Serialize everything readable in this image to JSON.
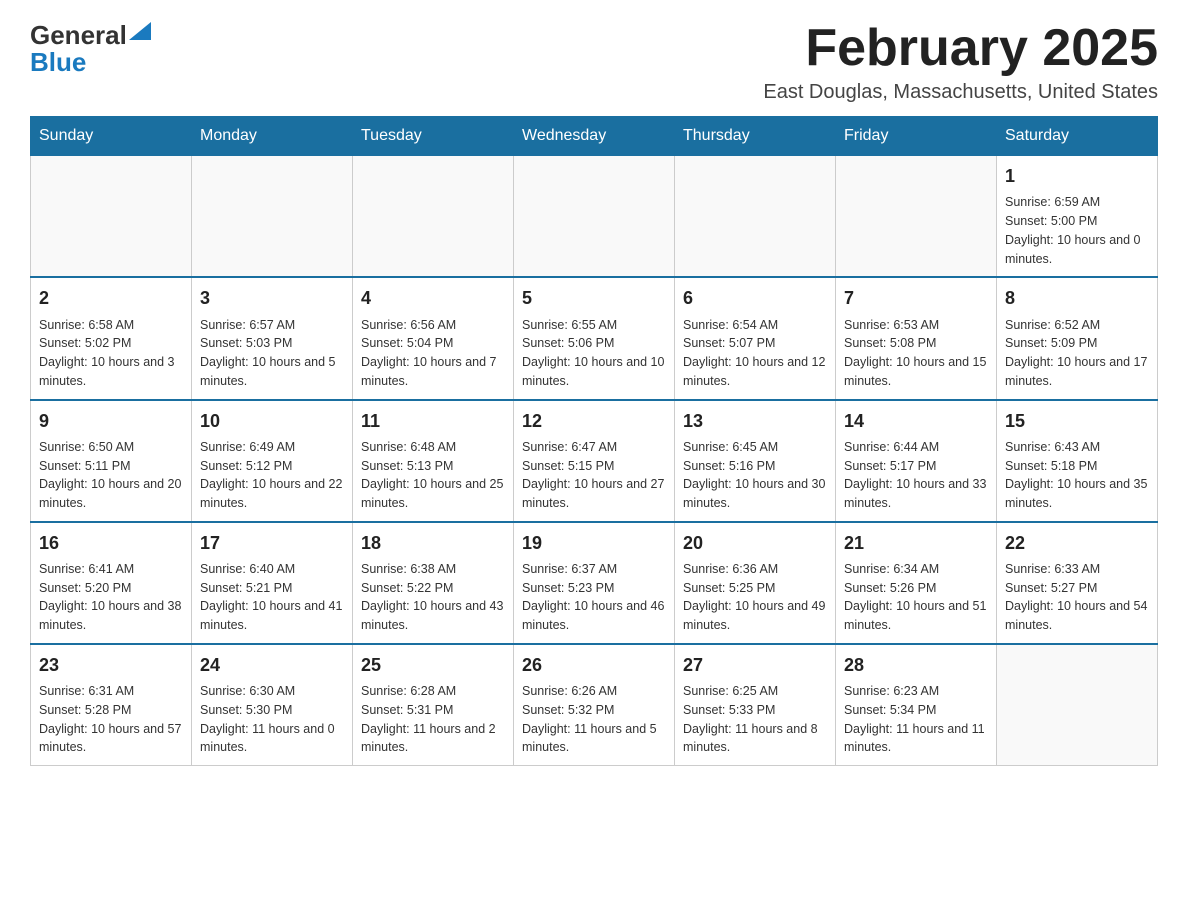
{
  "logo": {
    "general": "General",
    "blue": "Blue"
  },
  "title": "February 2025",
  "location": "East Douglas, Massachusetts, United States",
  "days_of_week": [
    "Sunday",
    "Monday",
    "Tuesday",
    "Wednesday",
    "Thursday",
    "Friday",
    "Saturday"
  ],
  "weeks": [
    [
      {
        "day": "",
        "info": ""
      },
      {
        "day": "",
        "info": ""
      },
      {
        "day": "",
        "info": ""
      },
      {
        "day": "",
        "info": ""
      },
      {
        "day": "",
        "info": ""
      },
      {
        "day": "",
        "info": ""
      },
      {
        "day": "1",
        "info": "Sunrise: 6:59 AM\nSunset: 5:00 PM\nDaylight: 10 hours and 0 minutes."
      }
    ],
    [
      {
        "day": "2",
        "info": "Sunrise: 6:58 AM\nSunset: 5:02 PM\nDaylight: 10 hours and 3 minutes."
      },
      {
        "day": "3",
        "info": "Sunrise: 6:57 AM\nSunset: 5:03 PM\nDaylight: 10 hours and 5 minutes."
      },
      {
        "day": "4",
        "info": "Sunrise: 6:56 AM\nSunset: 5:04 PM\nDaylight: 10 hours and 7 minutes."
      },
      {
        "day": "5",
        "info": "Sunrise: 6:55 AM\nSunset: 5:06 PM\nDaylight: 10 hours and 10 minutes."
      },
      {
        "day": "6",
        "info": "Sunrise: 6:54 AM\nSunset: 5:07 PM\nDaylight: 10 hours and 12 minutes."
      },
      {
        "day": "7",
        "info": "Sunrise: 6:53 AM\nSunset: 5:08 PM\nDaylight: 10 hours and 15 minutes."
      },
      {
        "day": "8",
        "info": "Sunrise: 6:52 AM\nSunset: 5:09 PM\nDaylight: 10 hours and 17 minutes."
      }
    ],
    [
      {
        "day": "9",
        "info": "Sunrise: 6:50 AM\nSunset: 5:11 PM\nDaylight: 10 hours and 20 minutes."
      },
      {
        "day": "10",
        "info": "Sunrise: 6:49 AM\nSunset: 5:12 PM\nDaylight: 10 hours and 22 minutes."
      },
      {
        "day": "11",
        "info": "Sunrise: 6:48 AM\nSunset: 5:13 PM\nDaylight: 10 hours and 25 minutes."
      },
      {
        "day": "12",
        "info": "Sunrise: 6:47 AM\nSunset: 5:15 PM\nDaylight: 10 hours and 27 minutes."
      },
      {
        "day": "13",
        "info": "Sunrise: 6:45 AM\nSunset: 5:16 PM\nDaylight: 10 hours and 30 minutes."
      },
      {
        "day": "14",
        "info": "Sunrise: 6:44 AM\nSunset: 5:17 PM\nDaylight: 10 hours and 33 minutes."
      },
      {
        "day": "15",
        "info": "Sunrise: 6:43 AM\nSunset: 5:18 PM\nDaylight: 10 hours and 35 minutes."
      }
    ],
    [
      {
        "day": "16",
        "info": "Sunrise: 6:41 AM\nSunset: 5:20 PM\nDaylight: 10 hours and 38 minutes."
      },
      {
        "day": "17",
        "info": "Sunrise: 6:40 AM\nSunset: 5:21 PM\nDaylight: 10 hours and 41 minutes."
      },
      {
        "day": "18",
        "info": "Sunrise: 6:38 AM\nSunset: 5:22 PM\nDaylight: 10 hours and 43 minutes."
      },
      {
        "day": "19",
        "info": "Sunrise: 6:37 AM\nSunset: 5:23 PM\nDaylight: 10 hours and 46 minutes."
      },
      {
        "day": "20",
        "info": "Sunrise: 6:36 AM\nSunset: 5:25 PM\nDaylight: 10 hours and 49 minutes."
      },
      {
        "day": "21",
        "info": "Sunrise: 6:34 AM\nSunset: 5:26 PM\nDaylight: 10 hours and 51 minutes."
      },
      {
        "day": "22",
        "info": "Sunrise: 6:33 AM\nSunset: 5:27 PM\nDaylight: 10 hours and 54 minutes."
      }
    ],
    [
      {
        "day": "23",
        "info": "Sunrise: 6:31 AM\nSunset: 5:28 PM\nDaylight: 10 hours and 57 minutes."
      },
      {
        "day": "24",
        "info": "Sunrise: 6:30 AM\nSunset: 5:30 PM\nDaylight: 11 hours and 0 minutes."
      },
      {
        "day": "25",
        "info": "Sunrise: 6:28 AM\nSunset: 5:31 PM\nDaylight: 11 hours and 2 minutes."
      },
      {
        "day": "26",
        "info": "Sunrise: 6:26 AM\nSunset: 5:32 PM\nDaylight: 11 hours and 5 minutes."
      },
      {
        "day": "27",
        "info": "Sunrise: 6:25 AM\nSunset: 5:33 PM\nDaylight: 11 hours and 8 minutes."
      },
      {
        "day": "28",
        "info": "Sunrise: 6:23 AM\nSunset: 5:34 PM\nDaylight: 11 hours and 11 minutes."
      },
      {
        "day": "",
        "info": ""
      }
    ]
  ]
}
